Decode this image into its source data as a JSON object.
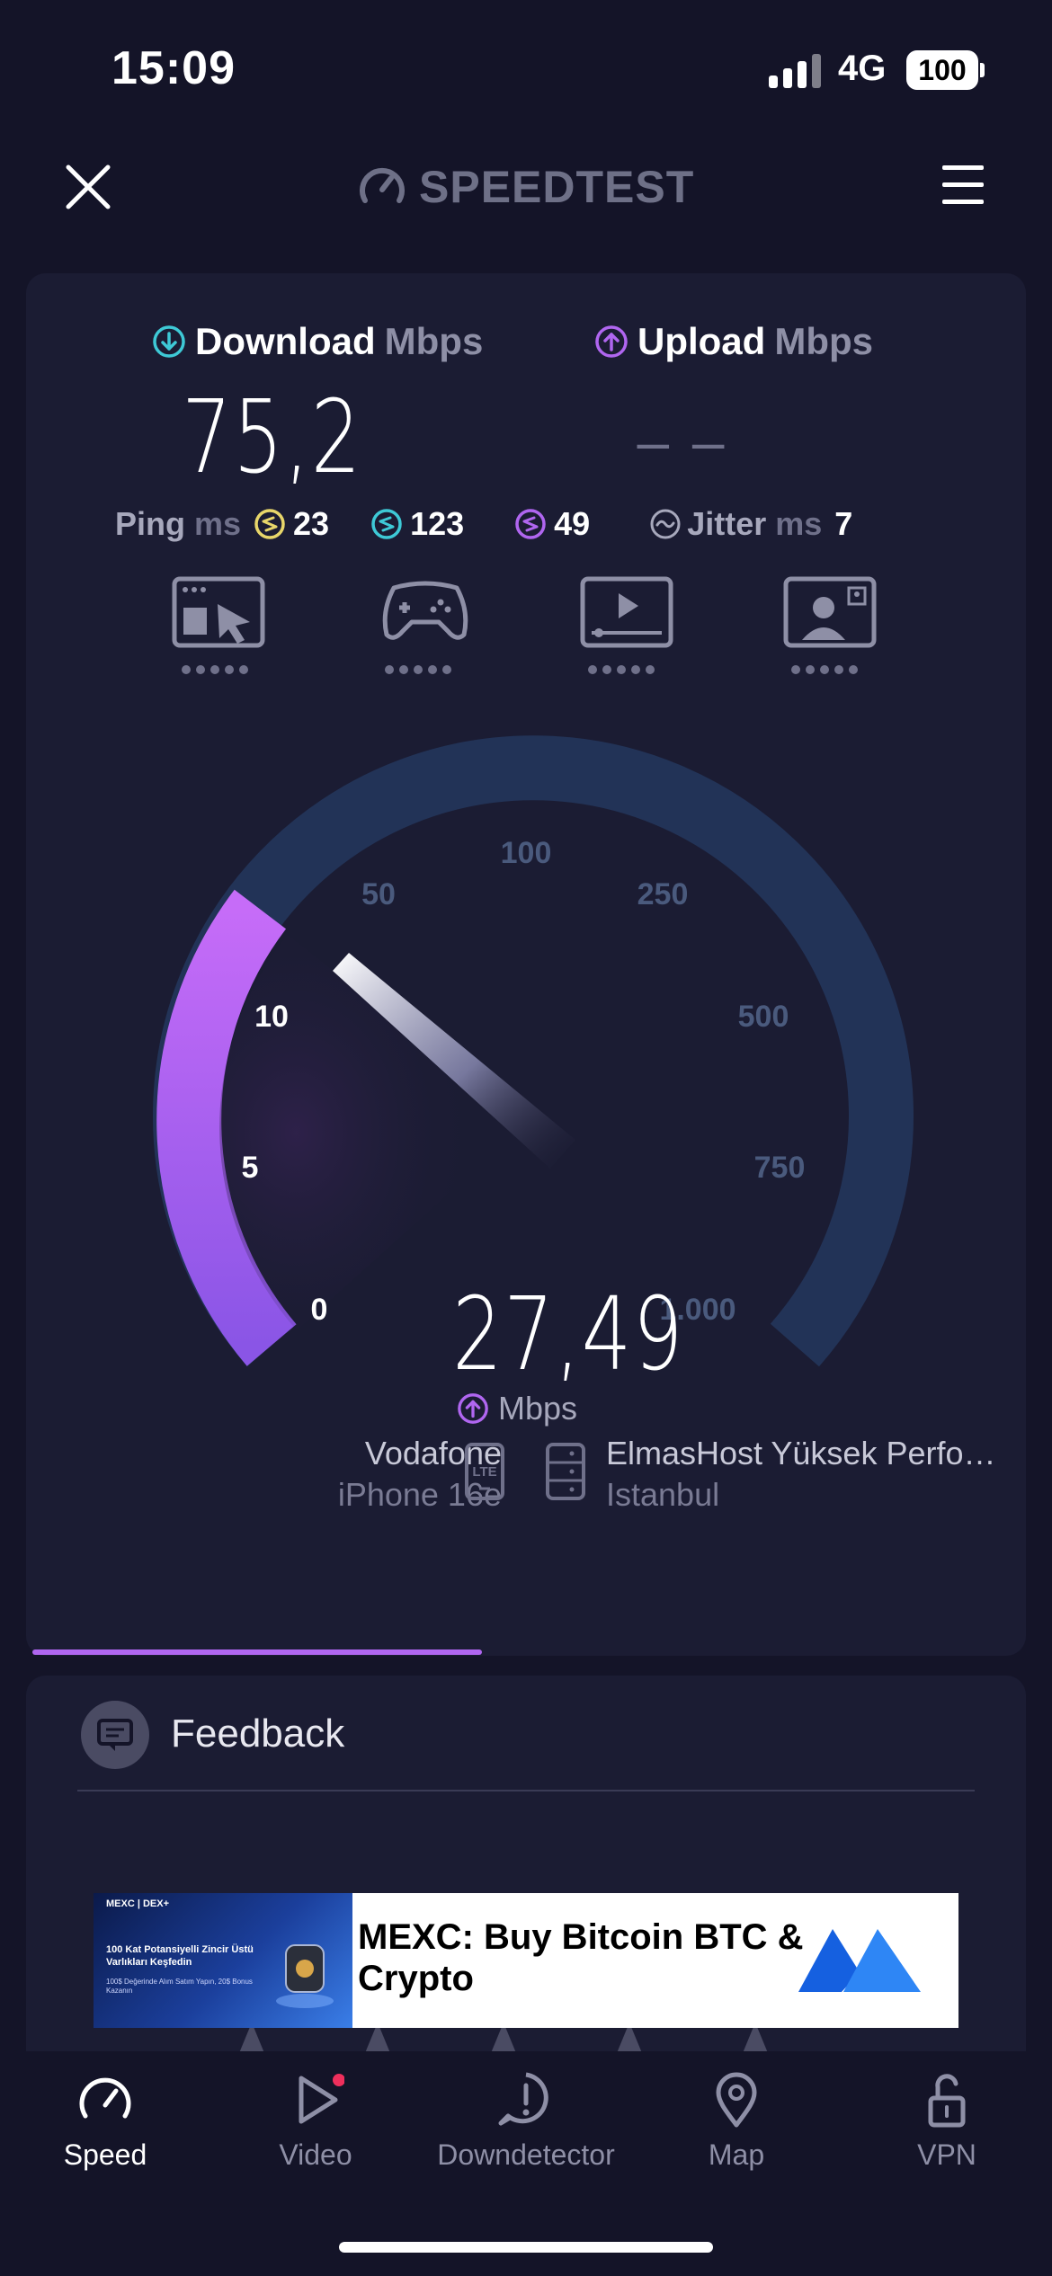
{
  "status_bar": {
    "time": "15:09",
    "network": "4G",
    "battery": "100"
  },
  "header": {
    "app_name": "SPEEDTEST"
  },
  "results": {
    "download": {
      "label": "Download",
      "unit": "Mbps",
      "value": "75,2"
    },
    "upload": {
      "label": "Upload",
      "unit": "Mbps",
      "value": "– –"
    },
    "ping": {
      "label": "Ping",
      "unit": "ms",
      "idle": "23",
      "download": "123",
      "upload": "49"
    },
    "jitter": {
      "label": "Jitter",
      "unit": "ms",
      "value": "7"
    }
  },
  "services": [
    "browsing-icon",
    "gaming-icon",
    "video-streaming-icon",
    "video-call-icon"
  ],
  "gauge": {
    "ticks": [
      "0",
      "5",
      "10",
      "50",
      "100",
      "250",
      "500",
      "750",
      "1.000"
    ],
    "current_value": "27,49",
    "unit": "Mbps"
  },
  "connection": {
    "provider": "Vodafone",
    "device": "iPhone 16e",
    "connection_type": "LTE",
    "server_name": "ElmasHost Yüksek Perfo…",
    "server_location": "Istanbul"
  },
  "test_progress": 0.45,
  "feedback": {
    "label": "Feedback"
  },
  "ad": {
    "brand": "MEXC | DEX+",
    "image_line1": "100 Kat Potansiyelli Zincir Üstü Varlıkları Keşfedin",
    "image_line2": "100$ Değerinde Alım Satım Yapın, 20$ Bonus Kazanın",
    "title": "MEXC: Buy Bitcoin BTC & Crypto"
  },
  "tabs": [
    {
      "label": "Speed",
      "icon": "speedometer-icon",
      "active": true
    },
    {
      "label": "Video",
      "icon": "play-icon",
      "active": false,
      "badge": true
    },
    {
      "label": "Downdetector",
      "icon": "alert-icon",
      "active": false
    },
    {
      "label": "Map",
      "icon": "map-pin-icon",
      "active": false
    },
    {
      "label": "VPN",
      "icon": "lock-icon",
      "active": false
    }
  ],
  "colors": {
    "background": "#141428",
    "card": "#1b1c33",
    "download_accent": "#3ec9d6",
    "upload_accent": "#b066f0",
    "idle_ping_accent": "#e8d66a",
    "gauge_track": "#223357"
  }
}
